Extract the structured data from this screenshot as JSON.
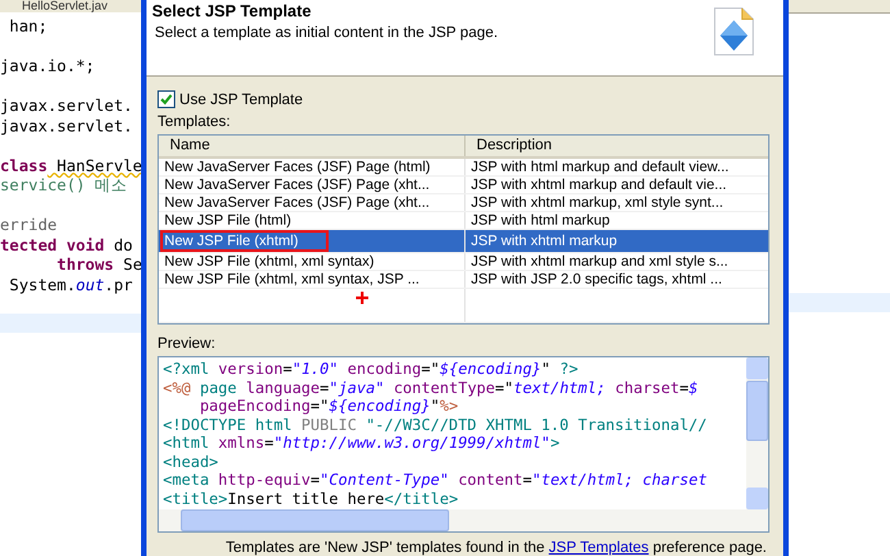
{
  "editor_left": {
    "tab": "HelloServlet.jav",
    "current_line_highlight": true,
    "lines": [
      {
        "kind": "code",
        "segments": [
          {
            "t": " han;",
            "kind": "plain"
          }
        ]
      },
      {
        "kind": "blank"
      },
      {
        "kind": "code",
        "segments": [
          {
            "t": "java.io.*;",
            "kind": "plain"
          }
        ]
      },
      {
        "kind": "blank"
      },
      {
        "kind": "code",
        "segments": [
          {
            "t": "javax.servlet.",
            "kind": "plain"
          }
        ]
      },
      {
        "kind": "code",
        "segments": [
          {
            "t": "javax.servlet.",
            "kind": "plain"
          }
        ]
      },
      {
        "kind": "blank"
      },
      {
        "kind": "code",
        "segments": [
          {
            "t": "class",
            "kind": "keyword"
          },
          {
            "t": " HanServle",
            "kind": "warn"
          }
        ]
      },
      {
        "kind": "code",
        "segments": [
          {
            "t": "service() 메소",
            "kind": "comment"
          }
        ]
      },
      {
        "kind": "blank"
      },
      {
        "kind": "code",
        "segments": [
          {
            "t": "erride",
            "kind": "annotation"
          }
        ]
      },
      {
        "kind": "code",
        "segments": [
          {
            "t": "tected void",
            "kind": "keyword"
          },
          {
            "t": " do",
            "kind": "plain"
          }
        ]
      },
      {
        "kind": "code",
        "segments": [
          {
            "t": "      throws",
            "kind": "keyword"
          },
          {
            "t": " Se",
            "kind": "plain"
          }
        ]
      },
      {
        "kind": "code",
        "segments": [
          {
            "t": " System.",
            "kind": "plain"
          },
          {
            "t": "out",
            "kind": "field"
          },
          {
            "t": ".pr",
            "kind": "plain"
          }
        ]
      }
    ]
  },
  "dialog": {
    "title": "Select JSP Template",
    "subtitle": "Select a template as initial content in the JSP page.",
    "use_template": {
      "label": "Use JSP Template",
      "checked": true
    },
    "templates_label": "Templates:",
    "table": {
      "columns": [
        "Name",
        "Description"
      ],
      "rows": [
        {
          "name": "New JavaServer Faces (JSF) Page (html)",
          "description": "JSP with html markup and default view...",
          "selected": false,
          "annotated": false
        },
        {
          "name": "New JavaServer Faces (JSF) Page (xht...",
          "description": "JSP with xhtml markup and default vie...",
          "selected": false,
          "annotated": false
        },
        {
          "name": "New JavaServer Faces (JSF) Page (xht...",
          "description": "JSP with xhtml markup, xml style synt...",
          "selected": false,
          "annotated": false
        },
        {
          "name": "New JSP File (html)",
          "description": "JSP with html markup",
          "selected": false,
          "annotated": false
        },
        {
          "name": "New JSP File (xhtml)",
          "description": "JSP with xhtml markup",
          "selected": true,
          "annotated": true
        },
        {
          "name": "New JSP File (xhtml, xml syntax)",
          "description": "JSP with xhtml markup and xml style s...",
          "selected": false,
          "annotated": false
        },
        {
          "name": "New JSP File (xhtml, xml syntax, JSP ...",
          "description": "JSP with JSP 2.0 specific tags, xhtml ...",
          "selected": false,
          "annotated": false
        }
      ]
    },
    "preview_label": "Preview:",
    "preview": [
      [
        {
          "t": "<?xml",
          "kind": "tag"
        },
        {
          "t": " version",
          "kind": "attr"
        },
        {
          "t": "=",
          "kind": "text"
        },
        {
          "t": "\"1.0\"",
          "kind": "val"
        },
        {
          "t": " encoding",
          "kind": "attr"
        },
        {
          "t": "=\"",
          "kind": "text"
        },
        {
          "t": "${encoding}",
          "kind": "val"
        },
        {
          "t": "\"",
          "kind": "text"
        },
        {
          "t": " ?>",
          "kind": "tag"
        }
      ],
      [
        {
          "t": "<%@",
          "kind": "jsp"
        },
        {
          "t": " page",
          "kind": "tag"
        },
        {
          "t": " language",
          "kind": "attr"
        },
        {
          "t": "=",
          "kind": "text"
        },
        {
          "t": "\"java\"",
          "kind": "val"
        },
        {
          "t": " contentType",
          "kind": "attr"
        },
        {
          "t": "=\"",
          "kind": "text"
        },
        {
          "t": "text/html;",
          "kind": "val"
        },
        {
          "t": " charset",
          "kind": "attr"
        },
        {
          "t": "=",
          "kind": "text"
        },
        {
          "t": "$",
          "kind": "val"
        }
      ],
      [
        {
          "t": "    pageEncoding",
          "kind": "attr"
        },
        {
          "t": "=\"",
          "kind": "text"
        },
        {
          "t": "${encoding}",
          "kind": "val"
        },
        {
          "t": "\"",
          "kind": "text"
        },
        {
          "t": "%>",
          "kind": "jsp"
        }
      ],
      [
        {
          "t": "<!DOCTYPE html",
          "kind": "tag"
        },
        {
          "t": " PUBLIC",
          "kind": "doc"
        },
        {
          "t": " \"-//W3C//DTD XHTML 1.0 Transitional//",
          "kind": "tag"
        }
      ],
      [
        {
          "t": "<html",
          "kind": "tag"
        },
        {
          "t": " xmlns",
          "kind": "attr"
        },
        {
          "t": "=",
          "kind": "text"
        },
        {
          "t": "\"http://www.w3.org/1999/xhtml\"",
          "kind": "val"
        },
        {
          "t": ">",
          "kind": "tag"
        }
      ],
      [
        {
          "t": "<head>",
          "kind": "tag"
        }
      ],
      [
        {
          "t": "<meta",
          "kind": "tag"
        },
        {
          "t": " http-equiv",
          "kind": "attr"
        },
        {
          "t": "=",
          "kind": "text"
        },
        {
          "t": "\"Content-Type\"",
          "kind": "val"
        },
        {
          "t": " content",
          "kind": "attr"
        },
        {
          "t": "=",
          "kind": "text"
        },
        {
          "t": "\"text/html; charset",
          "kind": "val"
        }
      ],
      [
        {
          "t": "<title>",
          "kind": "tag"
        },
        {
          "t": "Insert title here",
          "kind": "text"
        },
        {
          "t": "</title>",
          "kind": "tag"
        }
      ]
    ],
    "footer": {
      "before": "Templates are 'New JSP' templates found in the ",
      "link": "JSP Templates",
      "after": " preference page."
    }
  },
  "editor_right": {
    "current_line_highlight": true
  }
}
